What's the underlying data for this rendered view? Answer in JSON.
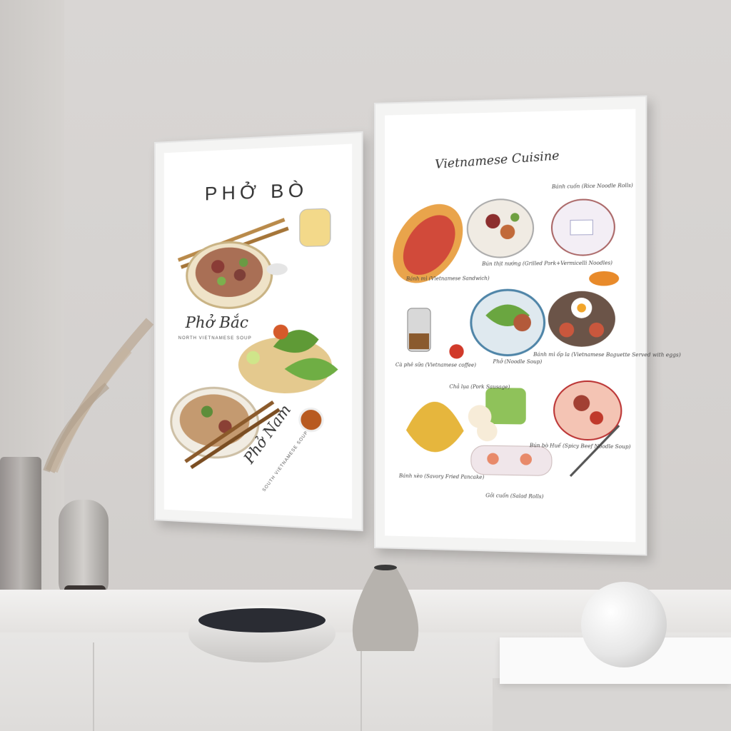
{
  "poster_left": {
    "title": "PHỞ BÒ",
    "pho_bac": "Phở Bắc",
    "pho_bac_sub": "NORTH VIETNAMESE SOUP",
    "pho_nam": "Phở Nam",
    "pho_nam_sub": "SOUTH VIETNAMESE SOUP"
  },
  "poster_right": {
    "title": "Vietnamese Cuisine",
    "items": [
      {
        "name": "Bánh mì (Vietnamese Sandwich)"
      },
      {
        "name": "Bún thịt nướng (Grilled Pork+Vermicelli Noodles)"
      },
      {
        "name": "Bánh cuốn (Rice Noodle Rolls)"
      },
      {
        "name": "Cà phê sữa (Vietnamese coffee)"
      },
      {
        "name": "Phở (Noodle Soup)"
      },
      {
        "name": "Bánh mì ốp la (Vietnamese Baguette Served with eggs)"
      },
      {
        "name": "Chả lụa (Pork Sausage)"
      },
      {
        "name": "Bún bò Huế (Spicy Beef Noodle Soup)"
      },
      {
        "name": "Bánh xèo (Savory Fried Pancake)"
      },
      {
        "name": "Gỏi cuốn (Salad Rolls)"
      }
    ]
  }
}
